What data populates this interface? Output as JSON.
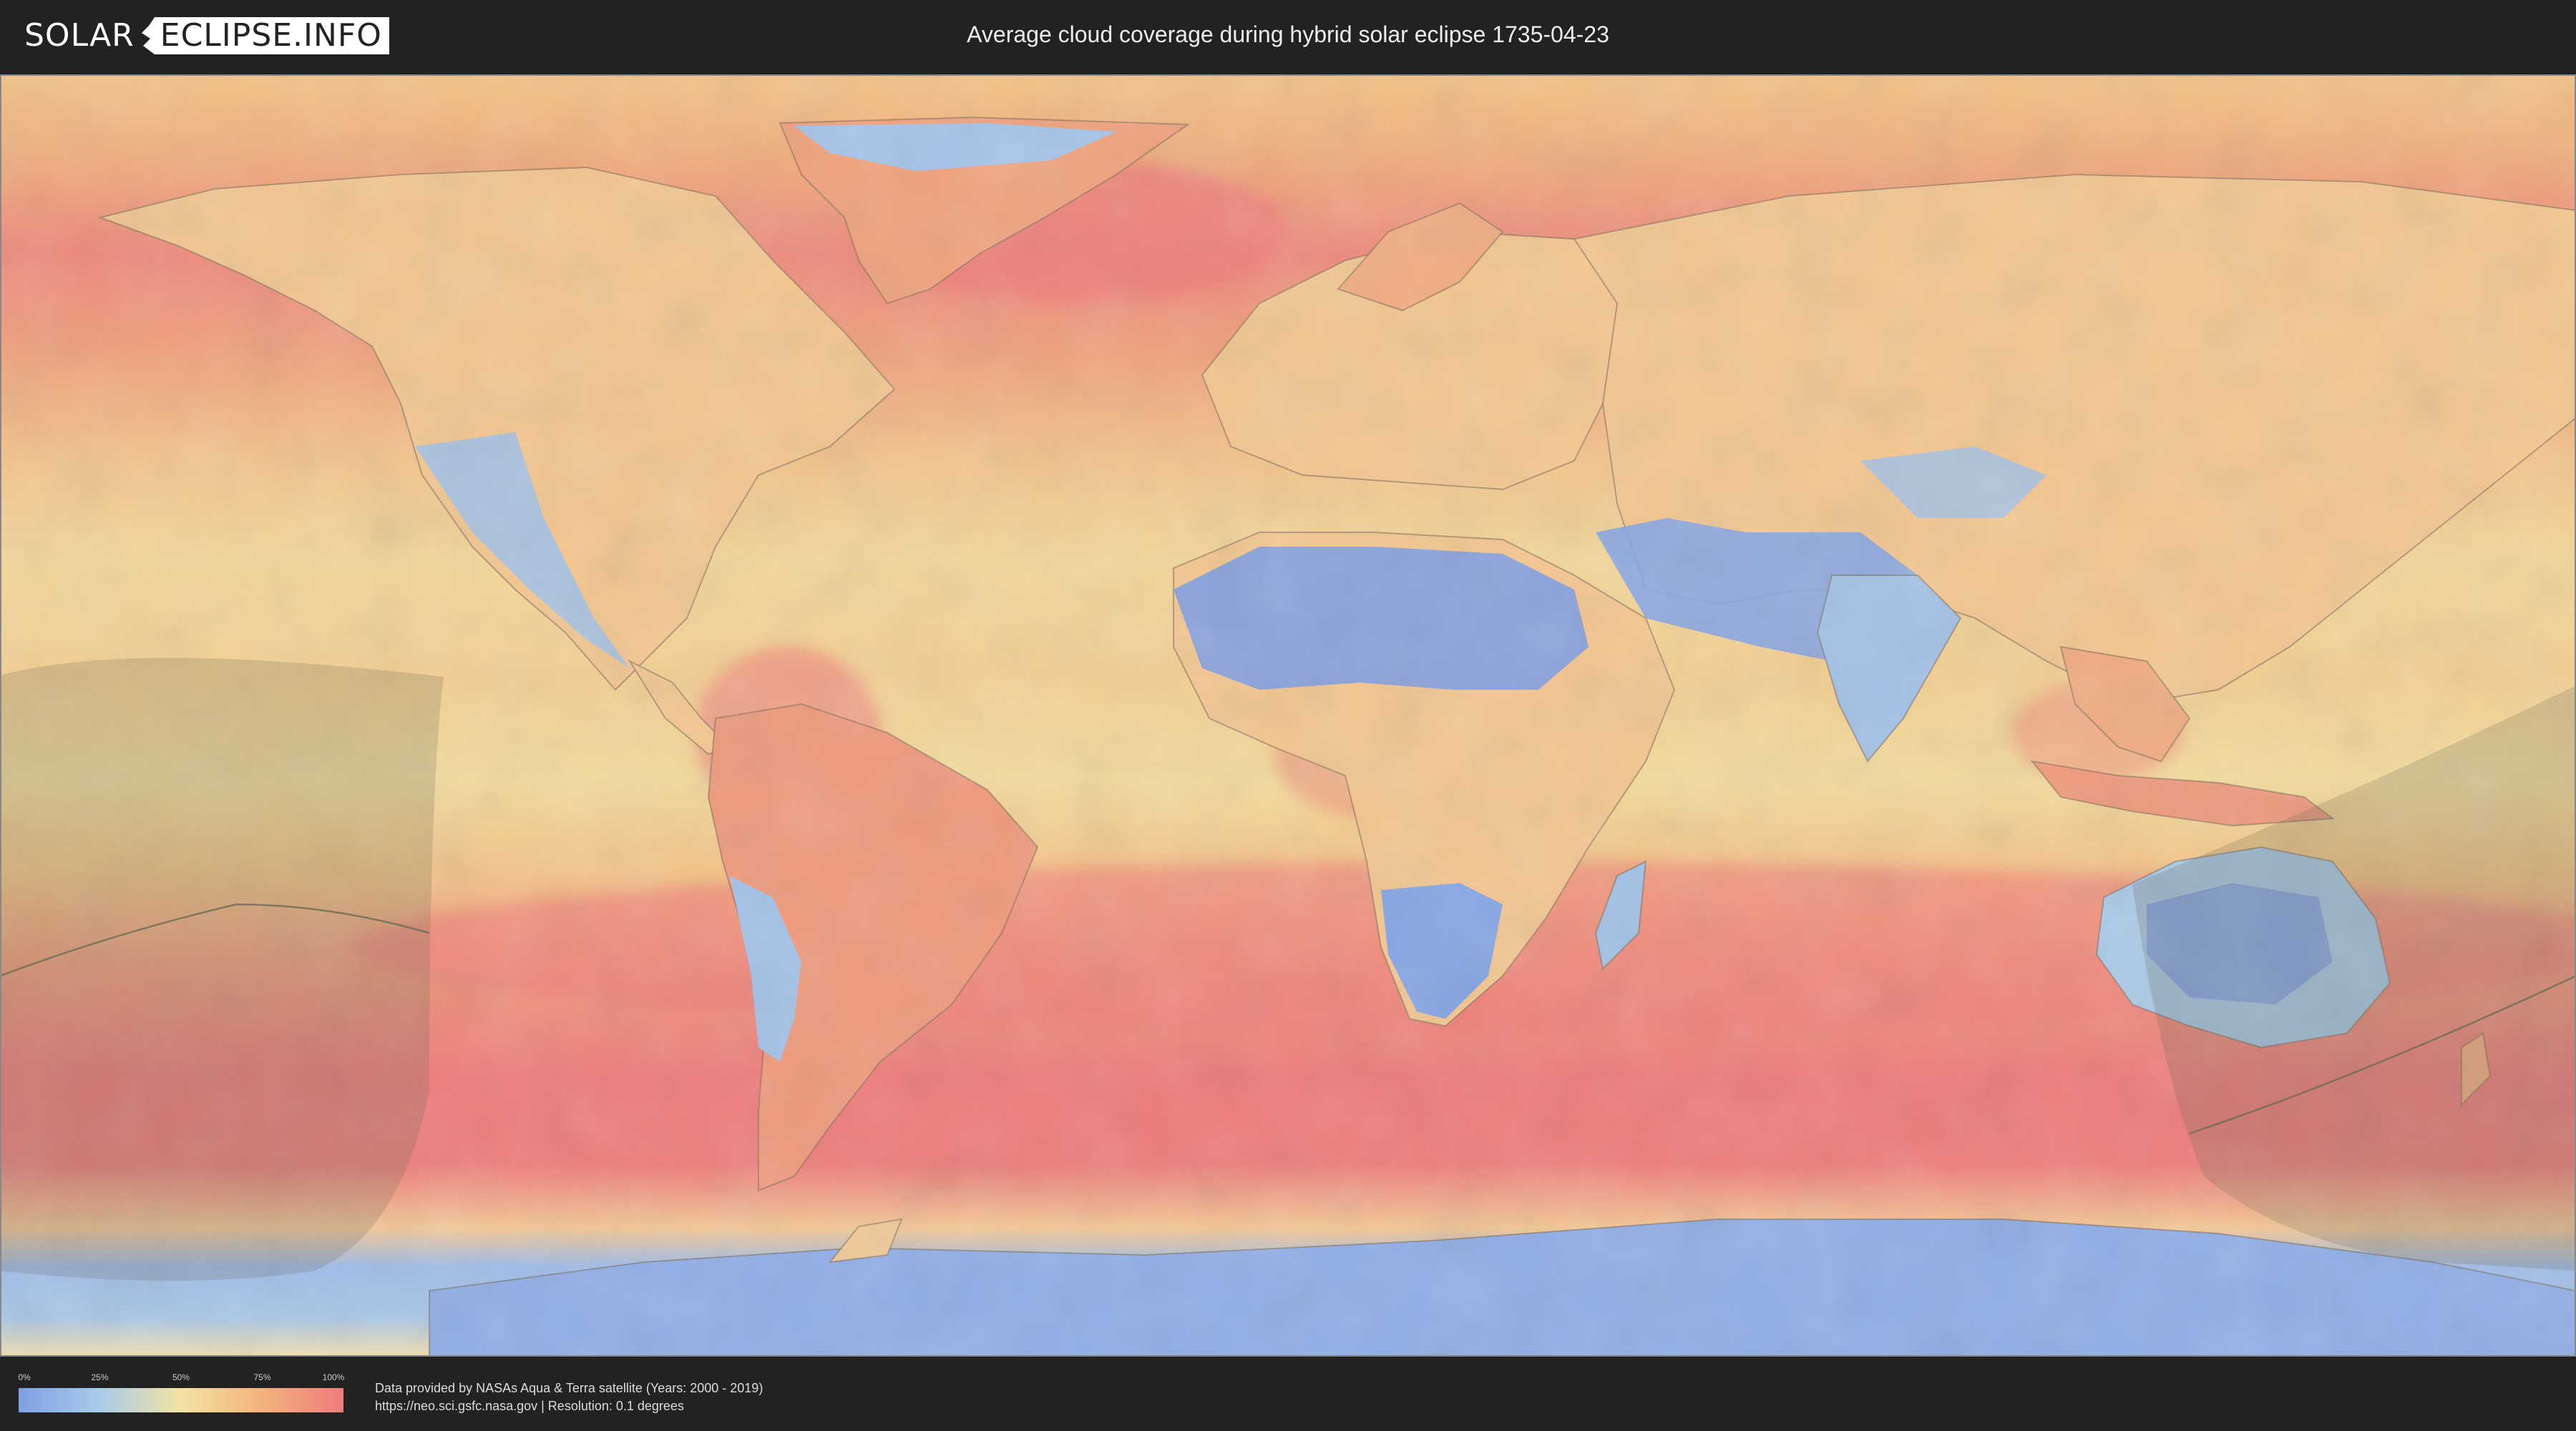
{
  "header": {
    "logo_left": "SOLAR",
    "logo_right": "ECLIPSE.INFO",
    "title": "Average cloud coverage during hybrid solar eclipse 1735-04-23"
  },
  "map": {
    "colors": {
      "cloud_0": "#7f9fe3",
      "cloud_25": "#a9cbe9",
      "cloud_50": "#f3e3a3",
      "cloud_75": "#f3b27e",
      "cloud_100": "#ee7c7c",
      "eclipse_shadow": "#6b6b55",
      "country_border": "#7a6a58"
    }
  },
  "legend": {
    "ticks": [
      "0%",
      "25%",
      "50%",
      "75%",
      "100%"
    ],
    "tick_values": [
      0,
      25,
      50,
      75,
      100
    ]
  },
  "footer": {
    "line1": "Data provided by NASAs Aqua & Terra satellite (Years: 2000 - 2019)",
    "line2": "https://neo.sci.gsfc.nasa.gov | Resolution: 0.1 degrees"
  }
}
